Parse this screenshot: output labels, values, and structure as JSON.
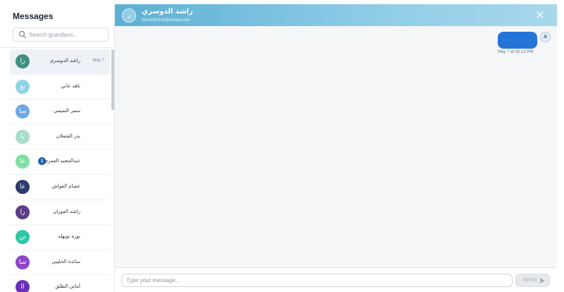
{
  "sidebar": {
    "title": "Messages",
    "search_placeholder": "Search guardians...",
    "contacts": [
      {
        "name": "راشد الدوسري",
        "initials": "را",
        "date": "May 7",
        "color": "#3f8f7f",
        "active": true
      },
      {
        "name": "ناهد عاني",
        "initials": "نع",
        "color": "#8fd3e8"
      },
      {
        "name": "سمر التميمي",
        "initials": "سا",
        "color": "#6fa8e6"
      },
      {
        "name": "بدر الشعلان",
        "initials": "با",
        "color": "#a9dcc9"
      },
      {
        "name": "عبدالمجيد العمري",
        "initials": "عا",
        "color": "#7fe0a2",
        "unread": "1"
      },
      {
        "name": "عصام الفواش",
        "initials": "عا",
        "color": "#2d3a6e"
      },
      {
        "name": "راشد الفوزان",
        "initials": "را",
        "color": "#5b3d8a"
      },
      {
        "name": "نورة نوبهلة",
        "initials": "نن",
        "color": "#2fc7a4"
      },
      {
        "name": "سائدة الحليبي",
        "initials": "سا",
        "color": "#8d47c9"
      },
      {
        "name": "أماني الطلق",
        "initials": "اا",
        "color": "#6a2fb8"
      }
    ]
  },
  "chat": {
    "header": {
      "avatar_initial": "ر",
      "name": "راشد الدوسري",
      "email": "Simon63140@icloud.com"
    },
    "messages": [
      {
        "text": ".",
        "sender_initial": "A",
        "time": "May 7 at 05:13 PM"
      }
    ],
    "composer": {
      "placeholder": "Type your message...",
      "send_label": "SEND"
    }
  }
}
